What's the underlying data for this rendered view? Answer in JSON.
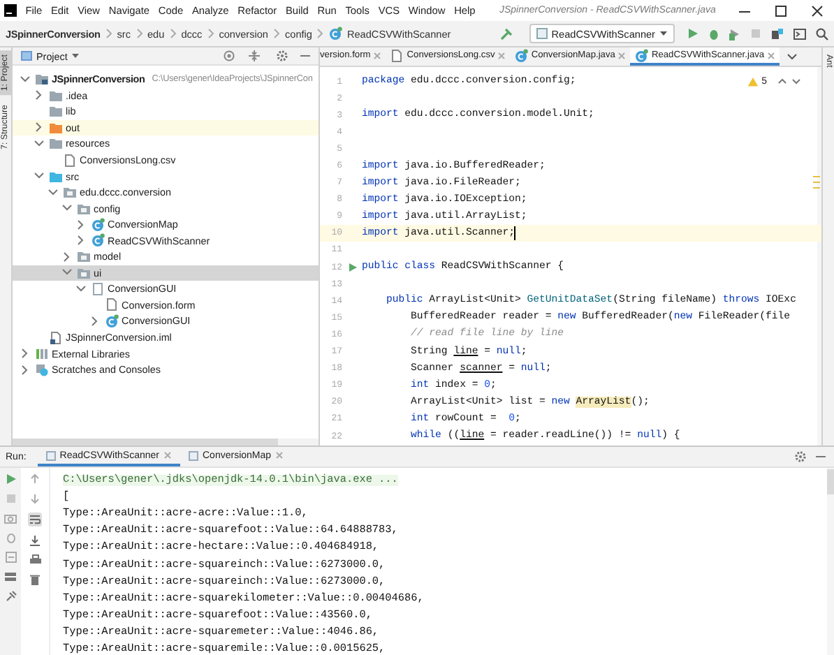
{
  "window": {
    "title": "JSpinnerConversion - ReadCSVWithScanner.java"
  },
  "menu": [
    "File",
    "Edit",
    "View",
    "Navigate",
    "Code",
    "Analyze",
    "Refactor",
    "Build",
    "Run",
    "Tools",
    "VCS",
    "Window",
    "Help"
  ],
  "breadcrumbs": [
    "JSpinnerConversion",
    "src",
    "edu",
    "dccc",
    "conversion",
    "config",
    "ReadCSVWithScanner"
  ],
  "run_configuration": "ReadCSVWithScanner",
  "tool_windows_left": [
    "1: Project",
    "7: Structure"
  ],
  "tool_windows_right": [
    "Ant"
  ],
  "project": {
    "title": "Project",
    "tree": [
      {
        "name": "JSpinnerConversion",
        "path": "C:\\Users\\gener\\IdeaProjects\\JSpinnerCon",
        "kind": "module",
        "expandable": true,
        "expanded": true,
        "selected": false,
        "children": [
          {
            "name": ".idea",
            "kind": "folder",
            "expandable": true,
            "expanded": false,
            "selected": false
          },
          {
            "name": "lib",
            "kind": "folder",
            "expandable": false,
            "selected": false
          },
          {
            "name": "out",
            "kind": "excluded",
            "expandable": true,
            "expanded": false,
            "selected": false
          },
          {
            "name": "resources",
            "kind": "folder",
            "expandable": true,
            "expanded": true,
            "selected": false,
            "children": [
              {
                "name": "ConversionsLong.csv",
                "kind": "file",
                "expandable": false,
                "selected": false
              }
            ]
          },
          {
            "name": "src",
            "kind": "source",
            "expandable": true,
            "expanded": true,
            "selected": false,
            "children": [
              {
                "name": "edu.dccc.conversion",
                "kind": "package",
                "expandable": true,
                "expanded": true,
                "selected": false,
                "children": [
                  {
                    "name": "config",
                    "kind": "package",
                    "expandable": true,
                    "expanded": true,
                    "selected": false,
                    "children": [
                      {
                        "name": "ConversionMap",
                        "kind": "class",
                        "expandable": true,
                        "expanded": false,
                        "selected": false
                      },
                      {
                        "name": "ReadCSVWithScanner",
                        "kind": "class",
                        "expandable": true,
                        "expanded": false,
                        "selected": false
                      }
                    ]
                  },
                  {
                    "name": "model",
                    "kind": "package",
                    "expandable": true,
                    "expanded": false,
                    "selected": false
                  },
                  {
                    "name": "ui",
                    "kind": "package",
                    "expandable": true,
                    "expanded": true,
                    "selected": true,
                    "children": [
                      {
                        "name": "ConversionGUI",
                        "kind": "form-group",
                        "expandable": true,
                        "expanded": true,
                        "selected": false,
                        "children": [
                          {
                            "name": "Conversion.form",
                            "kind": "file",
                            "expandable": false,
                            "selected": false
                          },
                          {
                            "name": "ConversionGUI",
                            "kind": "class",
                            "expandable": true,
                            "expanded": false,
                            "selected": false
                          }
                        ]
                      }
                    ]
                  }
                ]
              }
            ]
          },
          {
            "name": "JSpinnerConversion.iml",
            "kind": "module-file",
            "expandable": false,
            "selected": false
          }
        ]
      },
      {
        "name": "External Libraries",
        "kind": "libraries",
        "expandable": true,
        "expanded": false,
        "selected": false
      },
      {
        "name": "Scratches and Consoles",
        "kind": "scratches",
        "expandable": true,
        "expanded": false,
        "selected": false
      }
    ]
  },
  "editor": {
    "tabs": [
      {
        "label": "version.form",
        "selected": false
      },
      {
        "label": "ConversionsLong.csv",
        "kind": "file",
        "selected": false
      },
      {
        "label": "ConversionMap.java",
        "kind": "class",
        "selected": false
      },
      {
        "label": "ReadCSVWithScanner.java",
        "kind": "class",
        "selected": true
      }
    ],
    "warnings": "5",
    "lines": [
      {
        "number": "1",
        "current": false,
        "run_marker": false,
        "segments": [
          {
            "kind": "keyword",
            "text": "package"
          },
          {
            "kind": "plain",
            "text": " edu.dccc.conversion.config;"
          }
        ]
      },
      {
        "number": "2",
        "current": false,
        "run_marker": false
      },
      {
        "number": "3",
        "current": false,
        "run_marker": false,
        "segments": [
          {
            "kind": "keyword",
            "text": "import"
          },
          {
            "kind": "plain",
            "text": " edu.dccc.conversion.model.Unit;"
          }
        ]
      },
      {
        "number": "4",
        "current": false,
        "run_marker": false
      },
      {
        "number": "5",
        "current": false,
        "run_marker": false
      },
      {
        "number": "6",
        "current": false,
        "run_marker": false,
        "segments": [
          {
            "kind": "keyword",
            "text": "import"
          },
          {
            "kind": "plain",
            "text": " java.io.BufferedReader;"
          }
        ]
      },
      {
        "number": "7",
        "current": false,
        "run_marker": false,
        "segments": [
          {
            "kind": "keyword",
            "text": "import"
          },
          {
            "kind": "plain",
            "text": " java.io.FileReader;"
          }
        ]
      },
      {
        "number": "8",
        "current": false,
        "run_marker": false,
        "segments": [
          {
            "kind": "keyword",
            "text": "import"
          },
          {
            "kind": "plain",
            "text": " java.io.IOException;"
          }
        ]
      },
      {
        "number": "9",
        "current": false,
        "run_marker": false,
        "segments": [
          {
            "kind": "keyword",
            "text": "import"
          },
          {
            "kind": "plain",
            "text": " java.util.ArrayList;"
          }
        ]
      },
      {
        "number": "10",
        "current": true,
        "run_marker": false,
        "segments": [
          {
            "kind": "keyword",
            "text": "import"
          },
          {
            "kind": "plain",
            "text": " java.util.Scanner;"
          }
        ]
      },
      {
        "number": "11",
        "current": false,
        "run_marker": false
      },
      {
        "number": "12",
        "current": false,
        "run_marker": true,
        "segments": [
          {
            "kind": "keyword",
            "text": "public class"
          },
          {
            "kind": "plain",
            "text": " ReadCSVWithScanner {"
          }
        ]
      },
      {
        "number": "13",
        "current": false,
        "run_marker": false
      },
      {
        "number": "14",
        "current": false,
        "run_marker": false,
        "segments": [
          {
            "kind": "keyword",
            "text": "    public"
          },
          {
            "kind": "plain",
            "text": " ArrayList<Unit> "
          },
          {
            "kind": "method",
            "text": "GetUnitDataSet"
          },
          {
            "kind": "plain",
            "text": "(String fileName) "
          },
          {
            "kind": "keyword",
            "text": "throws"
          },
          {
            "kind": "plain",
            "text": " IOExc"
          }
        ]
      },
      {
        "number": "15",
        "current": false,
        "run_marker": false,
        "segments": [
          {
            "kind": "plain",
            "text": "        BufferedReader reader = "
          },
          {
            "kind": "keyword",
            "text": "new"
          },
          {
            "kind": "plain",
            "text": " BufferedReader("
          },
          {
            "kind": "keyword",
            "text": "new"
          },
          {
            "kind": "plain",
            "text": " FileReader(file"
          }
        ]
      },
      {
        "number": "16",
        "current": false,
        "run_marker": false,
        "segments": [
          {
            "kind": "comment",
            "text": "        // read file line by line"
          }
        ]
      },
      {
        "number": "17",
        "current": false,
        "run_marker": false,
        "segments": [
          {
            "kind": "plain",
            "text": "        String "
          },
          {
            "kind": "underlined",
            "text": "line"
          },
          {
            "kind": "plain",
            "text": " = "
          },
          {
            "kind": "keyword",
            "text": "null"
          },
          {
            "kind": "plain",
            "text": ";"
          }
        ]
      },
      {
        "number": "18",
        "current": false,
        "run_marker": false,
        "segments": [
          {
            "kind": "plain",
            "text": "        Scanner "
          },
          {
            "kind": "underlined",
            "text": "scanner"
          },
          {
            "kind": "plain",
            "text": " = "
          },
          {
            "kind": "keyword",
            "text": "null"
          },
          {
            "kind": "plain",
            "text": ";"
          }
        ]
      },
      {
        "number": "19",
        "current": false,
        "run_marker": false,
        "segments": [
          {
            "kind": "keyword",
            "text": "        int"
          },
          {
            "kind": "plain",
            "text": " index = "
          },
          {
            "kind": "number",
            "text": "0"
          },
          {
            "kind": "plain",
            "text": ";"
          }
        ]
      },
      {
        "number": "20",
        "current": false,
        "run_marker": false,
        "segments": [
          {
            "kind": "plain",
            "text": "        ArrayList<Unit> list = "
          },
          {
            "kind": "keyword",
            "text": "new "
          },
          {
            "kind": "warning",
            "text": "ArrayList"
          },
          {
            "kind": "plain",
            "text": "();"
          }
        ]
      },
      {
        "number": "21",
        "current": false,
        "run_marker": false,
        "segments": [
          {
            "kind": "keyword",
            "text": "        int"
          },
          {
            "kind": "plain",
            "text": " rowCount =  "
          },
          {
            "kind": "number",
            "text": "0"
          },
          {
            "kind": "plain",
            "text": ";"
          }
        ]
      },
      {
        "number": "22",
        "current": false,
        "run_marker": false,
        "segments": [
          {
            "kind": "keyword",
            "text": "        while"
          },
          {
            "kind": "plain",
            "text": " (("
          },
          {
            "kind": "underlined",
            "text": "line"
          },
          {
            "kind": "plain",
            "text": " = reader.readLine()) != "
          },
          {
            "kind": "keyword",
            "text": "null"
          },
          {
            "kind": "plain",
            "text": ") {"
          }
        ]
      }
    ]
  },
  "run": {
    "label": "Run:",
    "tabs": [
      {
        "label": "ReadCSVWithScanner",
        "selected": true
      },
      {
        "label": "ConversionMap",
        "selected": false
      }
    ],
    "output": [
      {
        "kind": "command",
        "text": "C:\\Users\\gener\\.jdks\\openjdk-14.0.1\\bin\\java.exe ..."
      },
      {
        "kind": "plain",
        "text": "["
      },
      {
        "kind": "plain",
        "text": "Type::AreaUnit::acre-acre::Value::1.0,"
      },
      {
        "kind": "plain",
        "text": "Type::AreaUnit::acre-squarefoot::Value::64.64888783,"
      },
      {
        "kind": "plain",
        "text": "Type::AreaUnit::acre-hectare::Value::0.404684918,"
      },
      {
        "kind": "plain",
        "text": "Type::AreaUnit::acre-squareinch::Value::6273000.0,"
      },
      {
        "kind": "plain",
        "text": "Type::AreaUnit::acre-squareinch::Value::6273000.0,"
      },
      {
        "kind": "plain",
        "text": "Type::AreaUnit::acre-squarekilometer::Value::0.00404686,"
      },
      {
        "kind": "plain",
        "text": "Type::AreaUnit::acre-squarefoot::Value::43560.0,"
      },
      {
        "kind": "plain",
        "text": "Type::AreaUnit::acre-squaremeter::Value::4046.86,"
      },
      {
        "kind": "plain",
        "text": "Type::AreaUnit::acre-squaremile::Value::0.0015625,"
      }
    ]
  }
}
